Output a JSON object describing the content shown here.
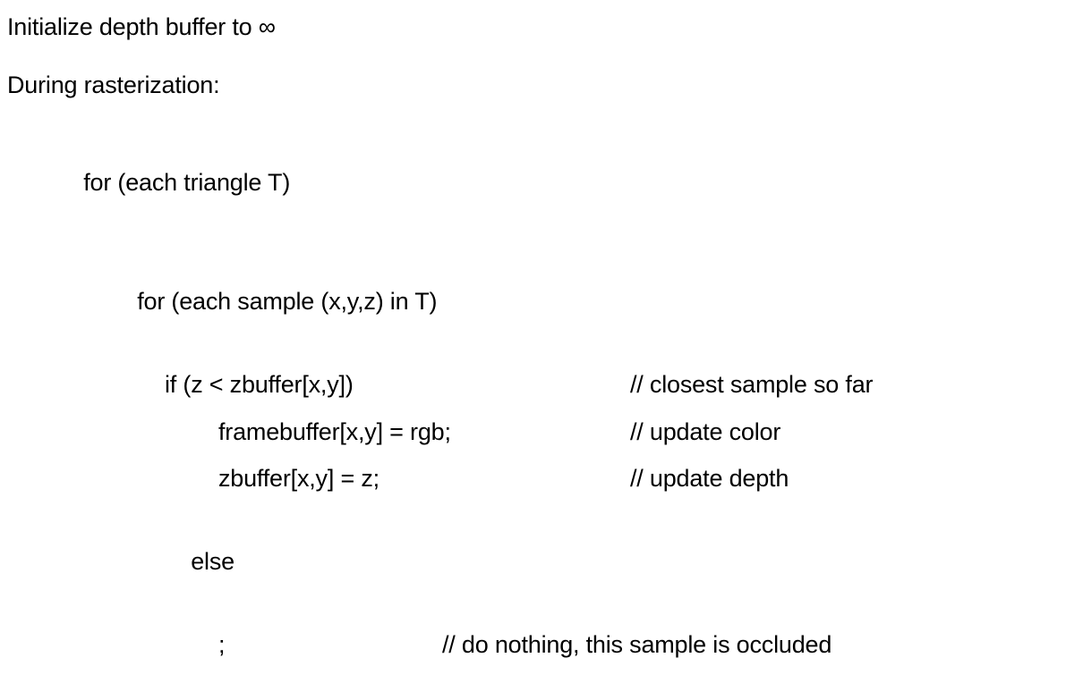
{
  "intro": {
    "line1": "Initialize depth buffer to ∞",
    "line2": "During rasterization:"
  },
  "code": {
    "l1": "for (each triangle T)",
    "l2": "for (each sample (x,y,z) in T)",
    "l3_left": "if (z < zbuffer[x,y])",
    "l3_right": "// closest sample so far",
    "l4_left": "framebuffer[x,y] = rgb;",
    "l4_right": "// update color",
    "l5_left": "zbuffer[x,y] = z;",
    "l5_right": "// update depth",
    "l6": "else",
    "l7_left": ";",
    "l7_right": "// do nothing, this sample is occluded"
  },
  "layout": {
    "col_comment": 640,
    "col_comment_last": 430
  }
}
